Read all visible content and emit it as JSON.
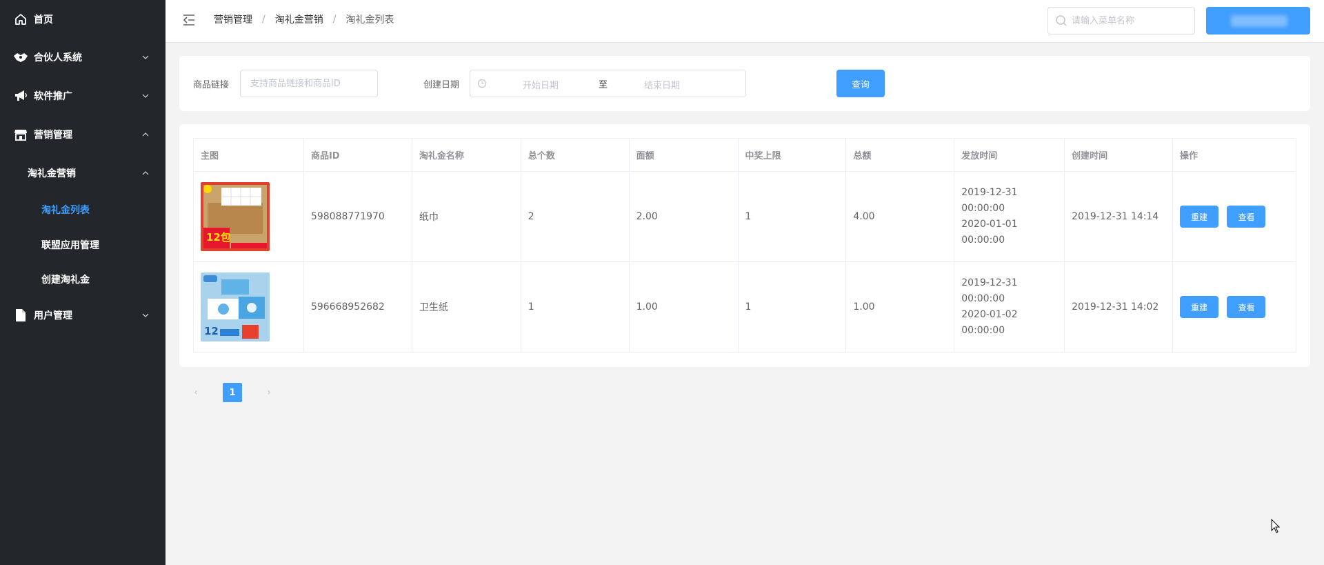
{
  "sidebar": {
    "home": "首页",
    "partner": "合伙人系统",
    "software": "软件推广",
    "marketing": "营销管理",
    "taoli": "淘礼金营销",
    "taoli_list": "淘礼金列表",
    "alliance": "联盟应用管理",
    "create": "创建淘礼金",
    "users": "用户管理"
  },
  "header": {
    "breadcrumb": [
      "营销管理",
      "淘礼金营销",
      "淘礼金列表"
    ],
    "search_placeholder": "请输入菜单名称"
  },
  "filter": {
    "link_label": "商品链接",
    "link_placeholder": "支持商品链接和商品ID",
    "date_label": "创建日期",
    "start_placeholder": "开始日期",
    "to": "至",
    "end_placeholder": "结束日期",
    "query_button": "查询"
  },
  "table": {
    "columns": [
      "主图",
      "商品ID",
      "淘礼金名称",
      "总个数",
      "面额",
      "中奖上限",
      "总额",
      "发放时间",
      "创建时间",
      "操作"
    ],
    "rows": [
      {
        "image_icon": "tissue-box-product-image",
        "id": "598088771970",
        "name": "纸巾",
        "count": "2",
        "face": "2.00",
        "limit": "1",
        "total": "4.00",
        "issue_start": "2019-12-31 00:00:00",
        "issue_end": "2020-01-01 00:00:00",
        "created": "2019-12-31 14:14",
        "rebuild": "重建",
        "view": "查看"
      },
      {
        "image_icon": "toilet-paper-product-image",
        "id": "596668952682",
        "name": "卫生纸",
        "count": "1",
        "face": "1.00",
        "limit": "1",
        "total": "1.00",
        "issue_start": "2019-12-31 00:00:00",
        "issue_end": "2020-01-02 00:00:00",
        "created": "2019-12-31 14:02",
        "rebuild": "重建",
        "view": "查看"
      }
    ]
  },
  "pagination": {
    "current": "1",
    "prev": "‹",
    "next": "›"
  },
  "colors": {
    "primary": "#409eff",
    "sidebar_bg": "#23272b",
    "page_bg": "#f3f3f3"
  }
}
